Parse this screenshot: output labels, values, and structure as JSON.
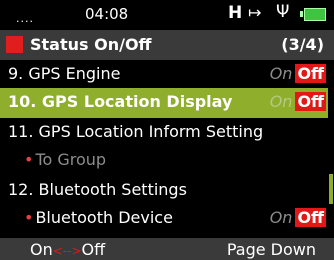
{
  "status_bar": {
    "time": "04:08",
    "network_indicator": "H",
    "icons": [
      "signal-dots-icon",
      "transfer-arrow-icon",
      "usb-icon",
      "battery-icon"
    ],
    "battery_color": "#3fc43f"
  },
  "title": {
    "label": "Status On/Off",
    "page": "(3/4)",
    "accent_color": "#e11e1e"
  },
  "rows": [
    {
      "label": "9. GPS Engine",
      "toggle": {
        "on": "On",
        "off": "Off"
      },
      "selected": false
    },
    {
      "label": "10. GPS Location Display",
      "toggle": {
        "on": "On",
        "off": "Off"
      },
      "selected": true
    },
    {
      "label": "11. GPS Location Inform Setting",
      "selected": false
    },
    {
      "label": "To Group",
      "sub": true,
      "selected": false
    },
    {
      "label": "12. Bluetooth Settings",
      "selected": false
    },
    {
      "label": "Bluetooth Device",
      "sub": true,
      "toggle": {
        "on": "On",
        "off": "Off"
      },
      "selected": false
    }
  ],
  "selected_color": "#8fae2c",
  "off_color": "#e01818",
  "softkeys": {
    "left_on": "On",
    "left_arrows": "<-->",
    "left_off": "Off",
    "right": "Page Down"
  }
}
